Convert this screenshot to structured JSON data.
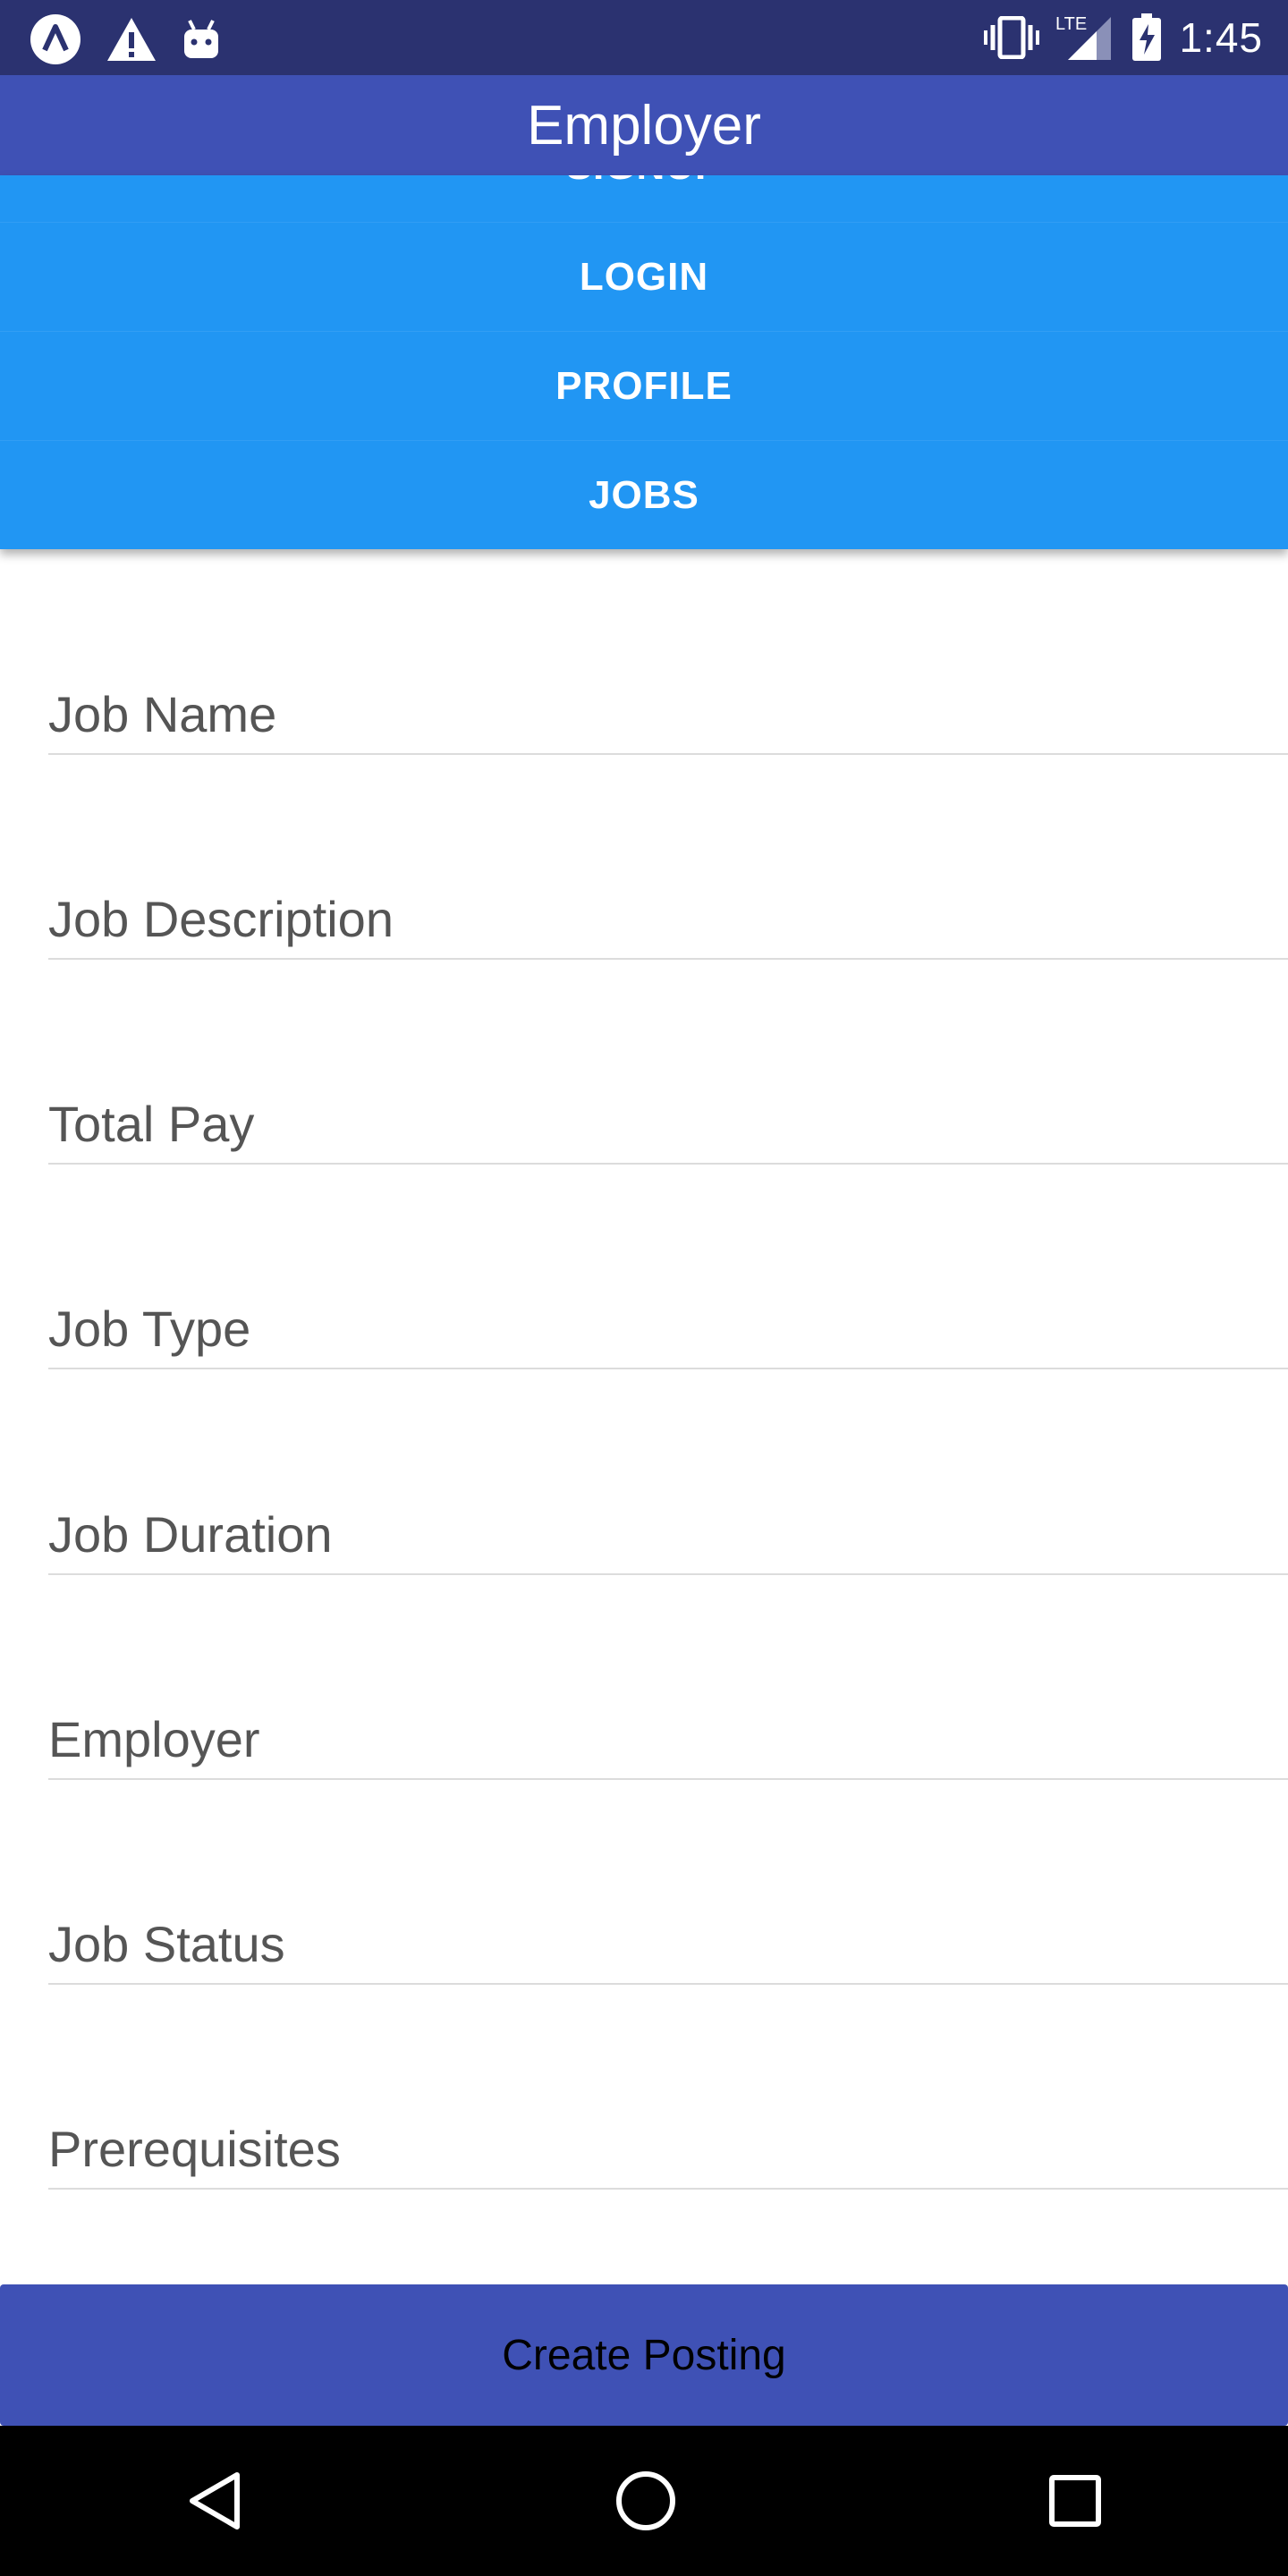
{
  "status_bar": {
    "time": "1:45",
    "network": "LTE",
    "icons": [
      "app-logo-icon",
      "warning-icon",
      "android-icon",
      "vibrate-icon",
      "signal-icon",
      "battery-charging-icon"
    ]
  },
  "app_bar": {
    "title": "Employer"
  },
  "nav_buttons": {
    "signup": "SIGNUP",
    "login": "LOGIN",
    "profile": "PROFILE",
    "jobs": "JOBS"
  },
  "form": {
    "fields": [
      {
        "placeholder": "Job Name",
        "value": ""
      },
      {
        "placeholder": "Job Description",
        "value": ""
      },
      {
        "placeholder": "Total Pay",
        "value": ""
      },
      {
        "placeholder": "Job Type",
        "value": ""
      },
      {
        "placeholder": "Job Duration",
        "value": ""
      },
      {
        "placeholder": "Employer",
        "value": ""
      },
      {
        "placeholder": "Job Status",
        "value": ""
      },
      {
        "placeholder": "Prerequisites",
        "value": ""
      }
    ],
    "submit_label": "Create Posting"
  },
  "colors": {
    "status_bar": "#2b3270",
    "primary": "#3f51b5",
    "nav_buttons": "#2196f3"
  },
  "system_nav": [
    "back-icon",
    "home-icon",
    "recents-icon"
  ]
}
